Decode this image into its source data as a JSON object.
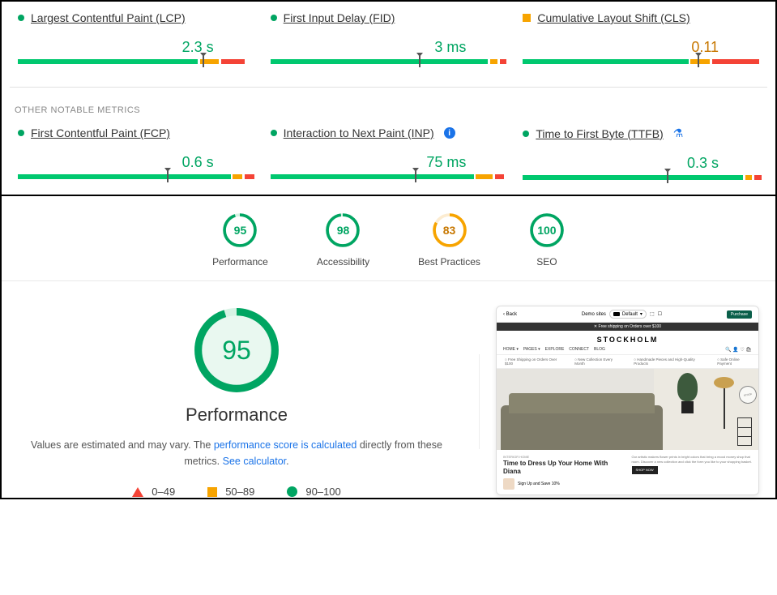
{
  "core_vitals": [
    {
      "label": "Largest Contentful Paint (LCP)",
      "value": "2.3 s",
      "status": "green",
      "dot": "green",
      "bar": {
        "g": 76,
        "o": 8,
        "r": 10
      },
      "marker": 78
    },
    {
      "label": "First Input Delay (FID)",
      "value": "3 ms",
      "status": "green",
      "dot": "green",
      "bar": {
        "g": 92,
        "o": 3,
        "r": 3
      },
      "marker": 63
    },
    {
      "label": "Cumulative Layout Shift (CLS)",
      "value": "0.11",
      "status": "orange",
      "dot": "square-orange",
      "bar": {
        "g": 70,
        "o": 8,
        "r": 20
      },
      "marker": 74
    }
  ],
  "notable_label": "OTHER NOTABLE METRICS",
  "notable_metrics": [
    {
      "label": "First Contentful Paint (FCP)",
      "value": "0.6 s",
      "status": "green",
      "dot": "green",
      "bar": {
        "g": 90,
        "o": 4,
        "r": 4
      },
      "marker": 63,
      "icon": null
    },
    {
      "label": "Interaction to Next Paint (INP)",
      "value": "75 ms",
      "status": "green",
      "dot": "green",
      "bar": {
        "g": 86,
        "o": 7,
        "r": 4
      },
      "marker": 61,
      "icon": "info"
    },
    {
      "label": "Time to First Byte (TTFB)",
      "value": "0.3 s",
      "status": "green",
      "dot": "green",
      "bar": {
        "g": 93,
        "o": 3,
        "r": 3
      },
      "marker": 61,
      "icon": "flask"
    }
  ],
  "gauges": [
    {
      "score": "95",
      "label": "Performance",
      "pct": 95,
      "color": "g"
    },
    {
      "score": "98",
      "label": "Accessibility",
      "pct": 98,
      "color": "g"
    },
    {
      "score": "83",
      "label": "Best Practices",
      "pct": 83,
      "color": "o"
    },
    {
      "score": "100",
      "label": "SEO",
      "pct": 100,
      "color": "g"
    }
  ],
  "big_gauge": {
    "score": "95",
    "pct": 95,
    "label": "Performance"
  },
  "desc": {
    "pre": "Values are estimated and may vary. The ",
    "link1": "performance score is calculated",
    "mid": " directly from these metrics. ",
    "link2": "See calculator"
  },
  "legend": [
    {
      "range": "0–49",
      "shape": "tri"
    },
    {
      "range": "50–89",
      "shape": "sq"
    },
    {
      "range": "90–100",
      "shape": "circ"
    }
  ],
  "preview": {
    "back": "Back",
    "chip_label": "Demo sites",
    "chip_val": "Default",
    "btn": "Purchase",
    "promo": "Free shipping on Orders over $100",
    "logo": "STOCKHOLM",
    "nav": [
      "HOME",
      "PAGES",
      "EXPLORE",
      "CONNECT",
      "BLOG"
    ],
    "sub": [
      "Free Shipping on Orders Over $100",
      "New Collection Every Month",
      "Handmade Pieces and High-Quality Products",
      "Safe Online Payment"
    ],
    "below_sub": "INTERIOR HOME",
    "below_title": "Time to Dress Up Your Home With Diana",
    "shop": "SHOP NOW",
    "signup": "Sign Up and Save 10%",
    "right_text": "Our artistic makers flower prints in bright colors that bring a mood money shop that room. Discover a new collection and click the form you like to your shopping basket."
  }
}
